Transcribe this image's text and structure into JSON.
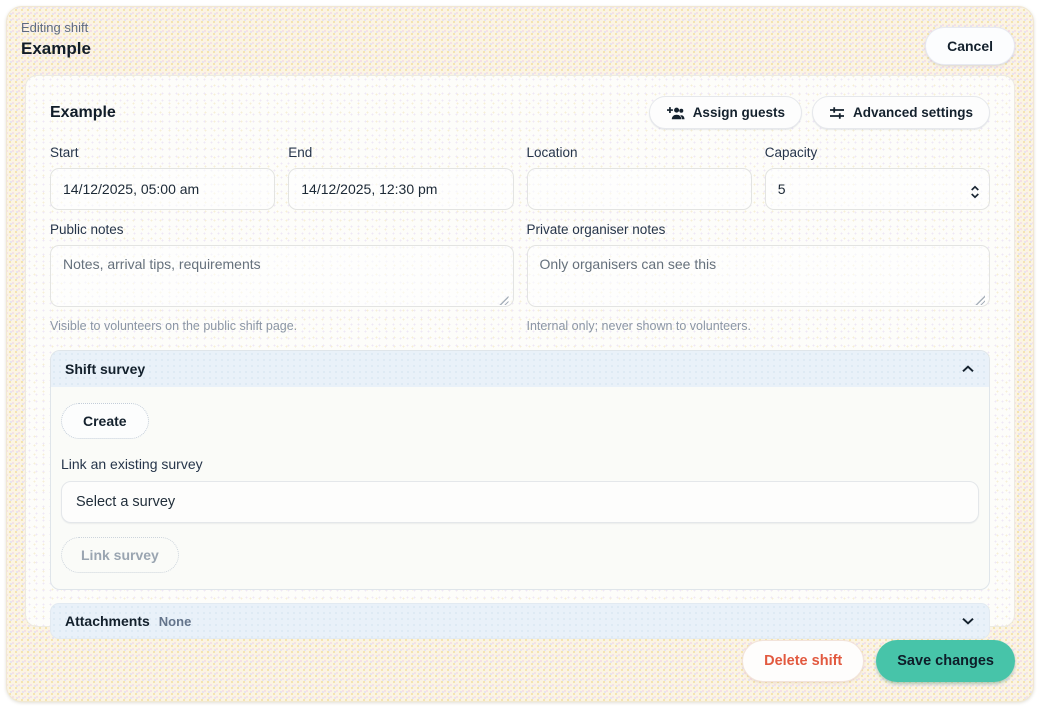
{
  "page": {
    "eyebrow": "Editing shift",
    "title": "Example",
    "cancel_label": "Cancel"
  },
  "card": {
    "heading": "Example",
    "actions": {
      "assign_guests": "Assign guests",
      "advanced_settings": "Advanced settings"
    },
    "fields": {
      "start": {
        "label": "Start",
        "value": "14/12/2025, 05:00 am"
      },
      "end": {
        "label": "End",
        "value": "14/12/2025, 12:30 pm"
      },
      "location": {
        "label": "Location",
        "value": ""
      },
      "capacity": {
        "label": "Capacity",
        "value": "5"
      }
    },
    "public_notes": {
      "label": "Public notes",
      "placeholder": "Notes, arrival tips, requirements",
      "helper": "Visible to volunteers on the public shift page."
    },
    "private_notes": {
      "label": "Private organiser notes",
      "placeholder": "Only organisers can see this",
      "helper": "Internal only; never shown to volunteers."
    },
    "survey_section": {
      "title": "Shift survey",
      "create_label": "Create",
      "link_label": "Link an existing survey",
      "select_placeholder": "Select a survey",
      "link_button_label": "Link survey"
    },
    "attachments_section": {
      "title": "Attachments",
      "badge": "None"
    }
  },
  "footer": {
    "delete_label": "Delete shift",
    "save_label": "Save changes"
  },
  "icons": {
    "assign_guests": "person-add-icon",
    "advanced_settings": "sliders-icon",
    "survey_collapse": "chevron-up-icon",
    "attachments_expand": "chevron-down-icon",
    "capacity": "number-stepper-icon"
  },
  "colors": {
    "panel_bg": "#fbf4e3",
    "card_bg": "#fdfdfa",
    "section_header_bg": "#e9f1f9",
    "save_button_bg": "#47c4a9",
    "delete_button_text": "#e2593f",
    "text_primary": "#14212d",
    "text_muted": "#8b96a5"
  }
}
